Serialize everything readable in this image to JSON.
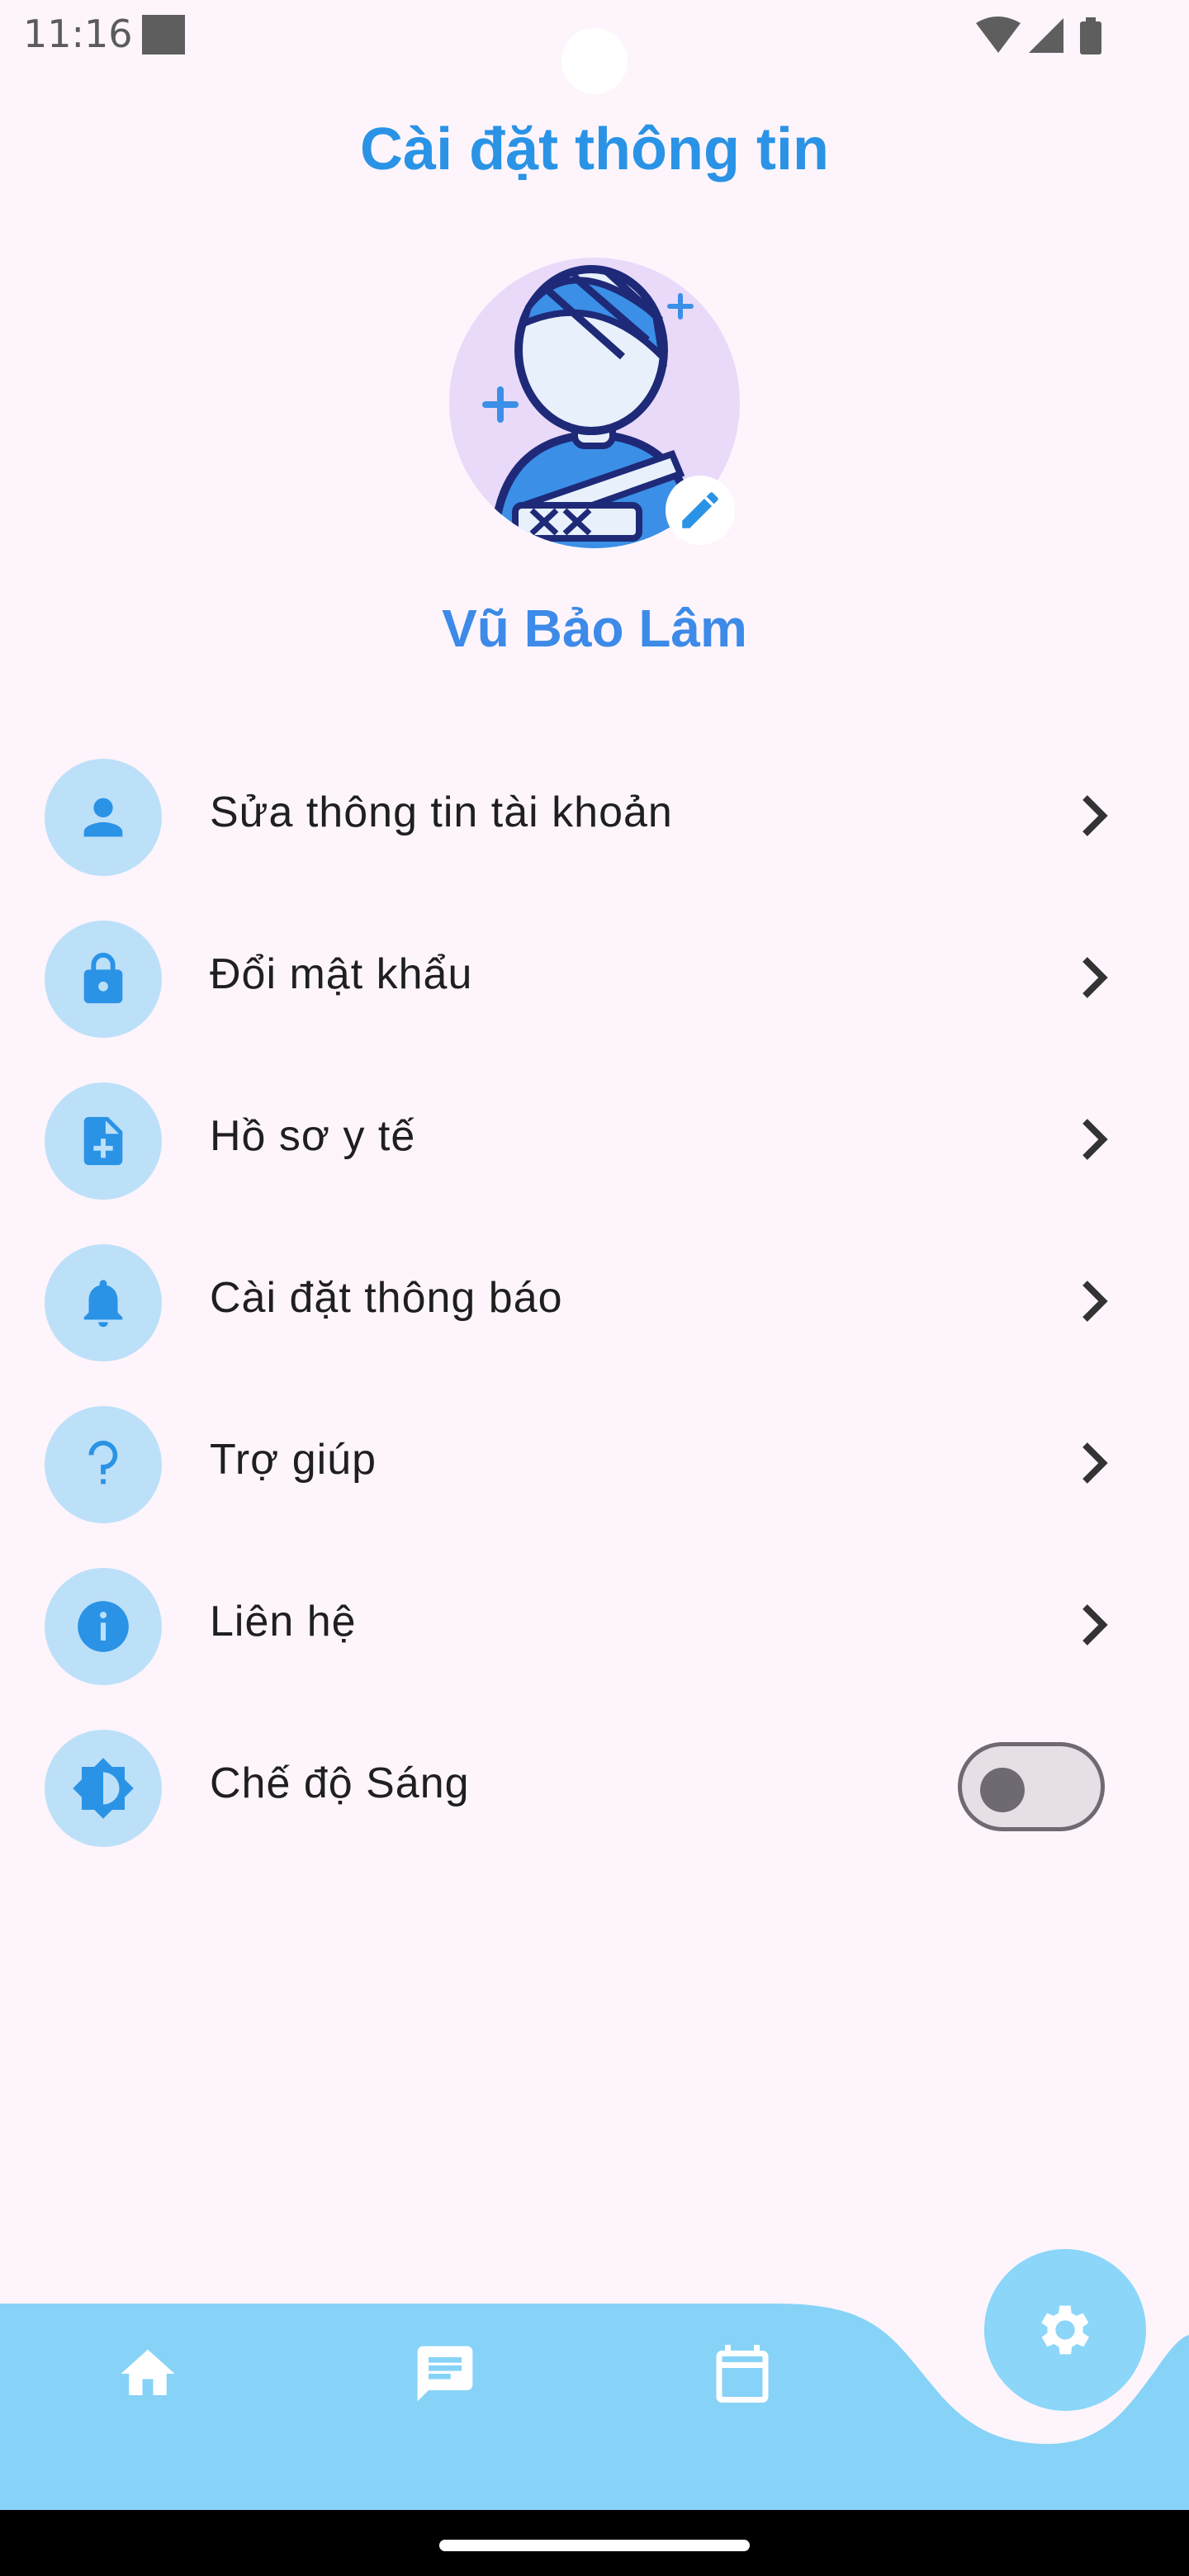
{
  "status_bar": {
    "time": "11:16",
    "icons": [
      "wifi-icon",
      "signal-icon",
      "battery-icon"
    ]
  },
  "header": {
    "title": "Cài đặt thông tin"
  },
  "profile": {
    "name": "Vũ Bảo Lâm",
    "avatar_icon": "injured-patient-avatar",
    "edit_icon": "pencil-icon"
  },
  "menu": {
    "items": [
      {
        "label": "Sửa thông tin tài khoản",
        "icon": "person-icon"
      },
      {
        "label": "Đổi mật khẩu",
        "icon": "lock-icon"
      },
      {
        "label": "Hồ sơ y tế",
        "icon": "medical-file-icon"
      },
      {
        "label": "Cài đặt thông báo",
        "icon": "bell-icon"
      },
      {
        "label": "Trợ giúp",
        "icon": "help-icon"
      },
      {
        "label": "Liên hệ",
        "icon": "info-icon"
      },
      {
        "label": "Chế độ Sáng",
        "icon": "brightness-icon",
        "toggle_on": false
      }
    ]
  },
  "bottom_nav": {
    "items": [
      "home-icon",
      "chat-icon",
      "calendar-icon",
      "settings-icon"
    ],
    "active": "settings-icon"
  },
  "colors": {
    "accent": "#2a93e6",
    "icon_circle": "#bde0f9",
    "nav_bar": "#87d3f8",
    "background": "#fdf5fb"
  }
}
